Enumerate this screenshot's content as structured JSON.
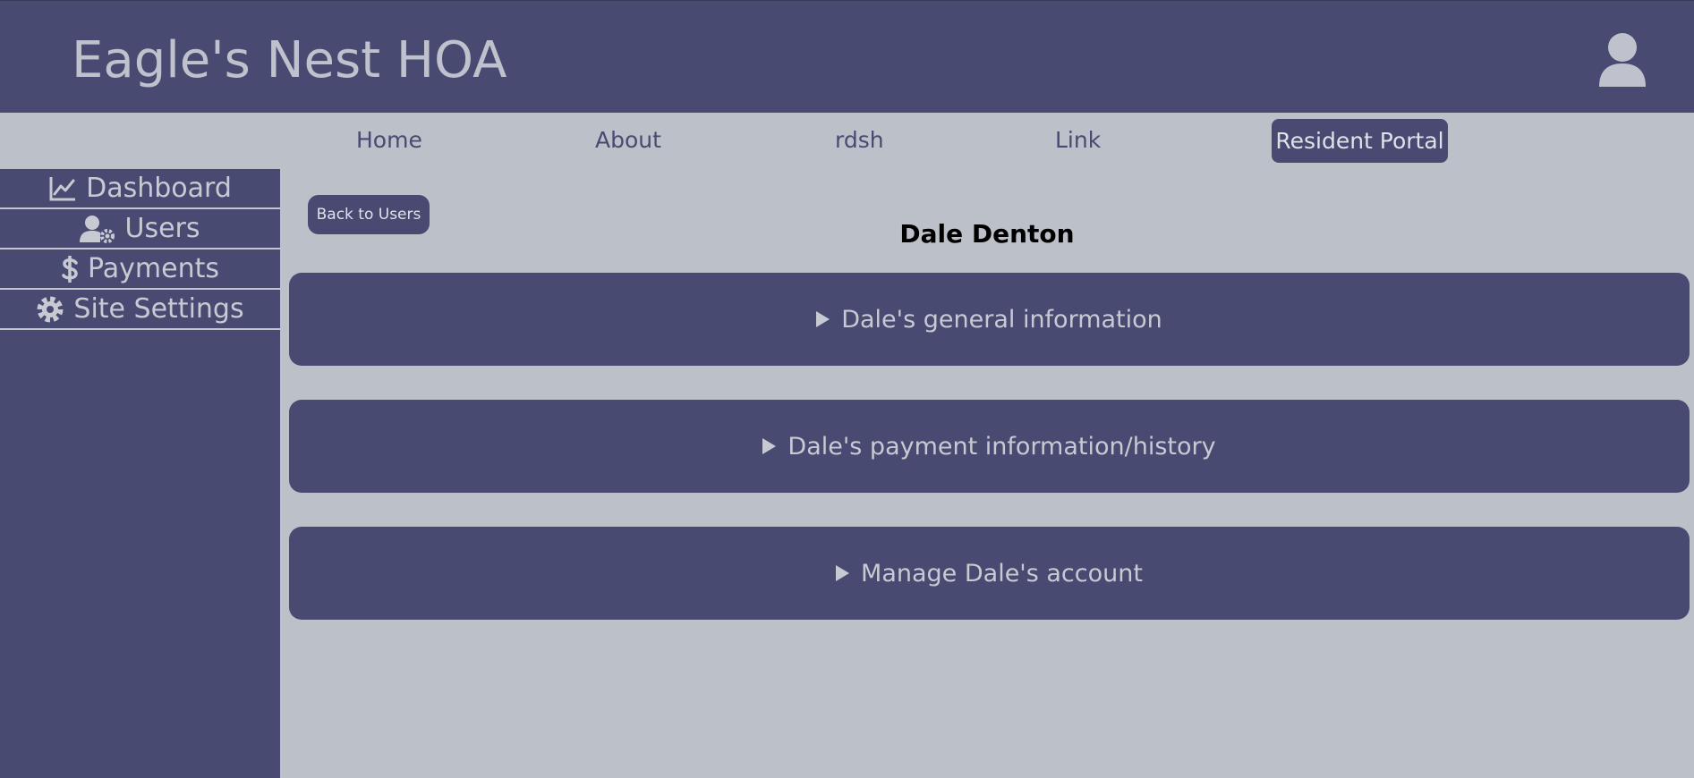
{
  "header": {
    "title": "Eagle's Nest HOA",
    "avatar_icon": "user-icon"
  },
  "topnav": {
    "items": [
      {
        "label": "Home"
      },
      {
        "label": "About"
      },
      {
        "label": "rdsh"
      },
      {
        "label": "Link"
      }
    ],
    "portal_label": "Resident Portal"
  },
  "sidebar": {
    "items": [
      {
        "label": "Dashboard",
        "icon": "chart-line-icon"
      },
      {
        "label": "Users",
        "icon": "user-gear-icon"
      },
      {
        "label": "Payments",
        "icon": "dollar-icon"
      },
      {
        "label": "Site Settings",
        "icon": "gear-icon"
      }
    ]
  },
  "main": {
    "back_label": "Back to Users",
    "user_name": "Dale Denton",
    "sections": [
      {
        "label": "Dale's general information"
      },
      {
        "label": "Dale's payment information/history"
      },
      {
        "label": "Manage Dale's account"
      }
    ]
  },
  "colors": {
    "primary": "#484a72",
    "background": "#bcc0c8",
    "light_text": "#c8cad3"
  }
}
